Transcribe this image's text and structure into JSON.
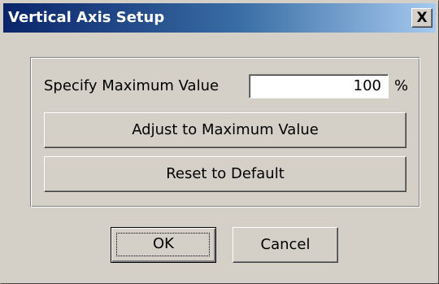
{
  "window": {
    "title": "Vertical Axis Setup",
    "close_glyph": "X",
    "colors": {
      "face": "#d4d0c8",
      "title_start": "#0a246a",
      "title_end": "#a6caf0",
      "title_text": "#ffffff"
    }
  },
  "form": {
    "max_label": "Specify Maximum Value",
    "max_value": "100",
    "unit": "%",
    "adjust_button": "Adjust to Maximum Value",
    "reset_button": "Reset to Default"
  },
  "footer": {
    "ok_button": "OK",
    "cancel_button": "Cancel"
  },
  "icons": {
    "close": "close-icon"
  }
}
